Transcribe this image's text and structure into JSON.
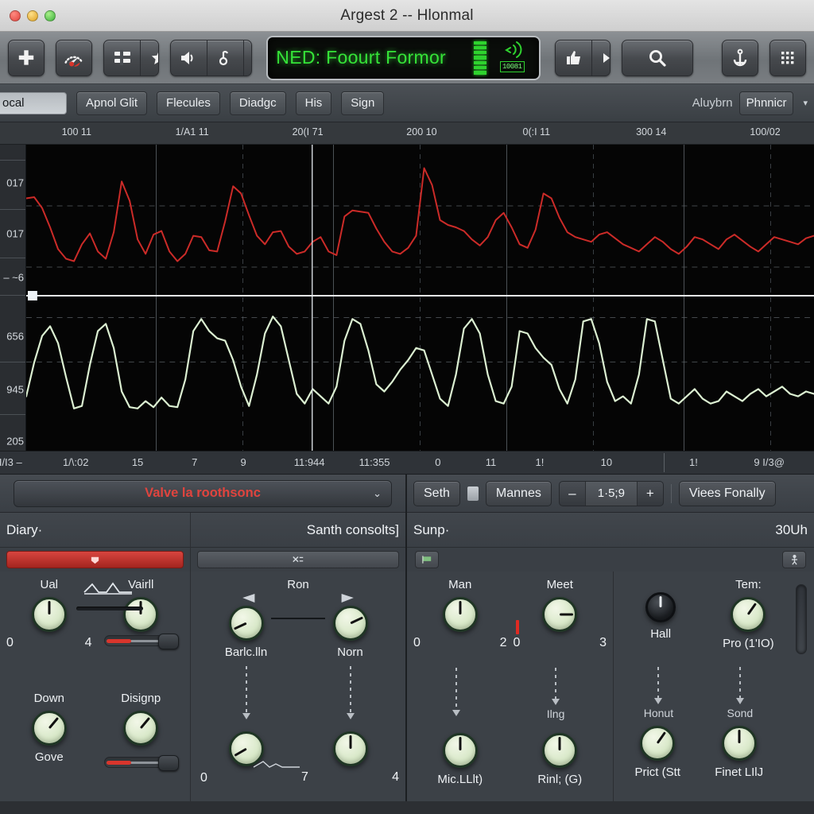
{
  "window": {
    "title": "Argest 2 -- Hlonmal",
    "traffic_lights": [
      "close-red",
      "minimize-yellow",
      "zoom-green"
    ]
  },
  "toolbar": {
    "buttons": [
      {
        "name": "add-button",
        "icon": "plus-icon",
        "label": "+"
      },
      {
        "name": "meter-button",
        "icon": "gauge-icon",
        "label": ""
      },
      {
        "name": "mixer-button",
        "icon": "mixer-icon",
        "label": ""
      },
      {
        "name": "favorite-button",
        "icon": "star-icon",
        "label": ""
      },
      {
        "name": "speaker-button",
        "icon": "speaker-icon",
        "label": ""
      },
      {
        "name": "note-button",
        "icon": "note-icon",
        "label": ""
      },
      {
        "name": "minus-button",
        "icon": "minus-icon",
        "label": "–"
      },
      {
        "name": "thumb-button",
        "icon": "thumb-icon",
        "label": ""
      },
      {
        "name": "fastforward-button",
        "icon": "fast-forward-icon",
        "label": ""
      },
      {
        "name": "search-button",
        "icon": "search-icon",
        "label": ""
      },
      {
        "name": "anchor-button",
        "icon": "anchor-icon",
        "label": ""
      },
      {
        "name": "grid-button",
        "icon": "grid-icon",
        "label": ""
      }
    ],
    "lcd": {
      "text": "NED: Foourt Formor",
      "badge": "10081",
      "meter_segments": 7,
      "meter_color": "#2fd32f",
      "text_color": "#35e338",
      "icon": "broadcast-icon"
    }
  },
  "subbar": {
    "search_value": "ocal",
    "search_placeholder": "ocal",
    "buttons": [
      "Apnol Glit",
      "Flecules",
      "Diadgc",
      "His",
      "Sign"
    ],
    "right_label": "Aluybrn",
    "right_combo": "Phnnicr",
    "combo_arrow": "▾"
  },
  "top_ruler": {
    "ticks": [
      {
        "label": "100 11",
        "x_pct": 9.4
      },
      {
        "label": "1/A1 11",
        "x_pct": 23.6
      },
      {
        "label": "20(I 71",
        "x_pct": 37.8
      },
      {
        "label": "200 10",
        "x_pct": 51.8
      },
      {
        "label": "0(:I 11",
        "x_pct": 65.9
      },
      {
        "label": "300 14",
        "x_pct": 80.0
      },
      {
        "label": "100/02",
        "x_pct": 94.0
      }
    ]
  },
  "bottom_ruler": {
    "ticks": [
      {
        "label": "I/I3 –",
        "x_pct": 1.3
      },
      {
        "label": "1/\\:02",
        "x_pct": 9.3
      },
      {
        "label": "15",
        "x_pct": 16.9
      },
      {
        "label": "7",
        "x_pct": 23.9
      },
      {
        "label": "9",
        "x_pct": 29.9
      },
      {
        "label": "11:944",
        "x_pct": 38.0
      },
      {
        "label": "11:355",
        "x_pct": 46.0
      },
      {
        "label": "0",
        "x_pct": 53.8
      },
      {
        "label": "11",
        "x_pct": 60.3
      },
      {
        "label": "1!",
        "x_pct": 66.3
      },
      {
        "label": "10",
        "x_pct": 74.5
      },
      {
        "label": "1!",
        "x_pct": 85.2
      },
      {
        "label": "9 I/3@",
        "x_pct": 94.5
      }
    ],
    "divider_x_pct": 81.5
  },
  "y_axis": {
    "labels": [
      {
        "text": "017",
        "y_pct": 12.5
      },
      {
        "text": "017",
        "y_pct": 29.0
      },
      {
        "text": "– ~6",
        "y_pct": 43.5
      },
      {
        "text": "656",
        "y_pct": 62.5
      },
      {
        "text": "945",
        "y_pct": 80.0
      },
      {
        "text": "205",
        "y_pct": 97.0
      }
    ],
    "rules_y_pct": [
      5.0,
      21.0,
      37.0,
      49.0,
      71.0,
      88.0
    ]
  },
  "chart_data": {
    "type": "line",
    "title": "",
    "xlabel": "",
    "ylabel": "",
    "grid": true,
    "legend_position": "none",
    "playhead_x_pct": 36.3,
    "playhead_color": "#d8dde2",
    "x": [
      0,
      1,
      2,
      3,
      4,
      5,
      6,
      7,
      8,
      9,
      10,
      11,
      12,
      13,
      14,
      15,
      16,
      17,
      18,
      19,
      20,
      21,
      22,
      23,
      24,
      25,
      26,
      27,
      28,
      29,
      30,
      31,
      32,
      33,
      34,
      35,
      36,
      37,
      38,
      39,
      40,
      41,
      42,
      43,
      44,
      45,
      46,
      47,
      48,
      49,
      50,
      51,
      52,
      53,
      54,
      55,
      56,
      57,
      58,
      59,
      60,
      61,
      62,
      63,
      64,
      65,
      66,
      67,
      68,
      69,
      70,
      71,
      72,
      73,
      74,
      75,
      76,
      77,
      78,
      79,
      80,
      81,
      82,
      83,
      84,
      85,
      86,
      87,
      88,
      89,
      90,
      91,
      92,
      93,
      94,
      95,
      96,
      97,
      98,
      99
    ],
    "series": [
      {
        "name": "red-waveform",
        "color": "#cc2b28",
        "ylim": [
          0,
          1
        ],
        "values": [
          0.74,
          0.75,
          0.66,
          0.5,
          0.32,
          0.24,
          0.22,
          0.36,
          0.45,
          0.3,
          0.24,
          0.46,
          0.88,
          0.72,
          0.4,
          0.28,
          0.44,
          0.47,
          0.3,
          0.22,
          0.28,
          0.43,
          0.42,
          0.31,
          0.3,
          0.55,
          0.84,
          0.78,
          0.6,
          0.43,
          0.36,
          0.46,
          0.47,
          0.34,
          0.28,
          0.3,
          0.38,
          0.42,
          0.3,
          0.27,
          0.59,
          0.64,
          0.63,
          0.62,
          0.49,
          0.38,
          0.3,
          0.28,
          0.33,
          0.43,
          0.99,
          0.85,
          0.56,
          0.52,
          0.5,
          0.47,
          0.4,
          0.35,
          0.42,
          0.56,
          0.62,
          0.5,
          0.36,
          0.33,
          0.48,
          0.78,
          0.74,
          0.58,
          0.46,
          0.42,
          0.4,
          0.38,
          0.44,
          0.46,
          0.41,
          0.36,
          0.33,
          0.3,
          0.36,
          0.42,
          0.38,
          0.32,
          0.28,
          0.34,
          0.42,
          0.4,
          0.36,
          0.32,
          0.4,
          0.44,
          0.39,
          0.34,
          0.3,
          0.36,
          0.42,
          0.4,
          0.38,
          0.36,
          0.41,
          0.43
        ]
      },
      {
        "name": "green-waveform",
        "color": "#dcf0d2",
        "ylim": [
          0,
          1
        ],
        "values": [
          0.22,
          0.5,
          0.72,
          0.8,
          0.66,
          0.38,
          0.12,
          0.14,
          0.48,
          0.76,
          0.82,
          0.62,
          0.26,
          0.13,
          0.12,
          0.18,
          0.13,
          0.21,
          0.14,
          0.13,
          0.36,
          0.76,
          0.86,
          0.76,
          0.7,
          0.68,
          0.52,
          0.3,
          0.14,
          0.4,
          0.74,
          0.88,
          0.8,
          0.52,
          0.24,
          0.16,
          0.28,
          0.22,
          0.16,
          0.3,
          0.68,
          0.86,
          0.82,
          0.6,
          0.32,
          0.26,
          0.34,
          0.44,
          0.52,
          0.62,
          0.6,
          0.4,
          0.2,
          0.14,
          0.4,
          0.78,
          0.86,
          0.74,
          0.4,
          0.18,
          0.16,
          0.3,
          0.76,
          0.74,
          0.62,
          0.54,
          0.48,
          0.28,
          0.16,
          0.36,
          0.84,
          0.86,
          0.66,
          0.34,
          0.18,
          0.22,
          0.16,
          0.4,
          0.86,
          0.84,
          0.52,
          0.2,
          0.16,
          0.22,
          0.28,
          0.2,
          0.16,
          0.18,
          0.26,
          0.22,
          0.18,
          0.24,
          0.28,
          0.22,
          0.26,
          0.3,
          0.24,
          0.22,
          0.26,
          0.24
        ]
      }
    ]
  },
  "left_panel": {
    "preset": {
      "label": "Valve la roothsonc",
      "color": "#e0443e",
      "chevron": "⌄"
    },
    "section_left": {
      "title": "Diary·",
      "badge_icon": "record-icon"
    },
    "section_right": {
      "title": "Santh consolts]",
      "badge_icon": "edit-icon"
    },
    "knobs_left": [
      {
        "name": "ual-knob",
        "label": "Ual",
        "angle": 0,
        "min": "0",
        "max": "4"
      },
      {
        "name": "vairll-knob",
        "label": "Vairll",
        "angle": 0,
        "min": "",
        "max": ""
      },
      {
        "name": "down-knob",
        "label": "Down",
        "angle": 140,
        "sublabel": "Gove"
      },
      {
        "name": "disignp-knob",
        "label": "Disignp",
        "angle": 140,
        "sublabel": ""
      }
    ],
    "knobs_right": [
      {
        "name": "barlclln-knob",
        "label": "Barlc.lln",
        "angle": -115,
        "top_label": "Ron"
      },
      {
        "name": "norn-knob",
        "label": "Norn",
        "angle": 65,
        "top_label": ""
      },
      {
        "name": "lower-left-knob",
        "label": "",
        "angle": -120,
        "value": "0"
      },
      {
        "name": "lower-right-knob",
        "label": "",
        "angle": 0,
        "value_a": "7",
        "value_b": "4"
      }
    ],
    "wave_glyph": "▁▃▁▂▁"
  },
  "right_panel": {
    "header": {
      "seth_button": "Seth",
      "square_icon": "square-icon",
      "mannes_button": "Mannes",
      "minus": "–",
      "stepper_value": "1·5;9",
      "plus": "+",
      "views_button": "Viees Fonally"
    },
    "section_left": {
      "title": "Sunp·",
      "badge_icon": "flag-icon"
    },
    "section_right": {
      "title": "30Uh",
      "badge_icon": "person-icon"
    },
    "knobs": [
      {
        "name": "man-knob",
        "label": "Man",
        "angle": 0,
        "min": "0",
        "max": "2"
      },
      {
        "name": "meet-knob",
        "label": "Meet",
        "angle": -90,
        "min": "0",
        "max": "3",
        "red_mark": true
      },
      {
        "name": "hall-knob",
        "label": "Hall",
        "angle": 0,
        "dark": true
      },
      {
        "name": "tem-knob",
        "label": "Tem:",
        "angle": -35,
        "sublabel": "Pro (1'IO)"
      },
      {
        "name": "miclllt-knob",
        "label": "Mic.LLlt)",
        "angle": 0
      },
      {
        "name": "rinlg-knob",
        "label": "Rinl; (G)",
        "angle": 0,
        "toplabel": "Ilng"
      },
      {
        "name": "prict-knob",
        "label": "Prict (Stt",
        "angle": -35,
        "toplabel": "Honut"
      },
      {
        "name": "finet-knob",
        "label": "Finet LIlJ",
        "angle": 0,
        "toplabel": "Sond"
      }
    ]
  }
}
